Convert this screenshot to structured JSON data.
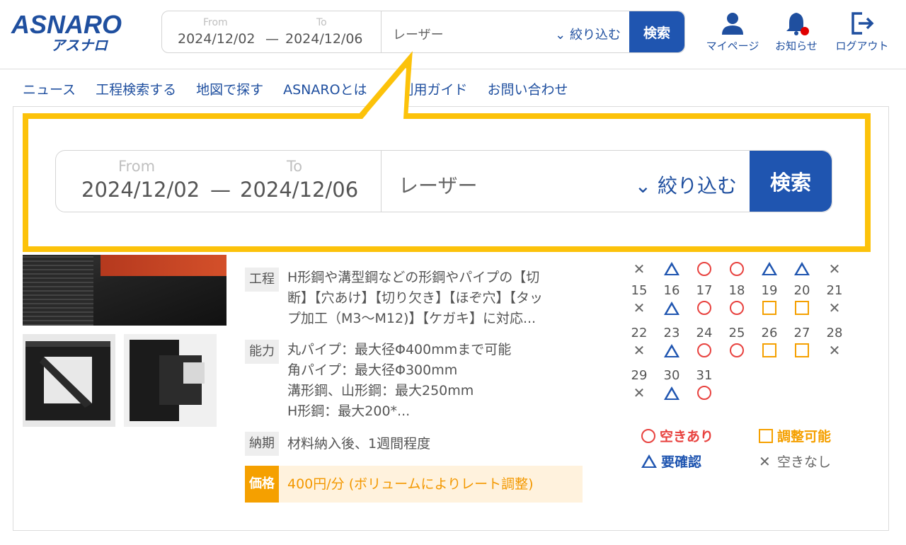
{
  "brand": {
    "logo": "ASNARO",
    "logo_sub": "アスナロ",
    "color": "#1f4f9f"
  },
  "search": {
    "from_label": "From",
    "to_label": "To",
    "from_date": "2024/12/02",
    "to_date": "2024/12/06",
    "separator": "—",
    "keyword": "レーザー",
    "filter_label": "絞り込む",
    "search_button": "検索"
  },
  "header_icons": {
    "mypage": "マイページ",
    "notifications": "お知らせ",
    "logout": "ログアウト"
  },
  "nav": [
    "ニュース",
    "工程検索する",
    "地図で探す",
    "ASNAROとは",
    "ご利用ガイド",
    "お問い合わせ"
  ],
  "detail": {
    "process_label": "工程",
    "process_lines": [
      "H形鋼や溝型鋼などの形鋼やパイプの【切",
      "断】【穴あけ】【切り欠き】【ほぞ穴】【タッ",
      "プ加工（M3～M12)】【ケガキ】に対応..."
    ],
    "capacity_label": "能力",
    "capacity_lines": [
      "丸パイプ：最大径Φ400mmまで可能",
      "角パイプ：最大径Φ300mm",
      "溝形鋼、山形鋼：最大250mm",
      "H形鋼：最大200*..."
    ],
    "delivery_label": "納期",
    "delivery_text": "材料納入後、1週間程度",
    "price_label": "価格",
    "price_text": "400円/分 (ボリュームによりレート調整)"
  },
  "calendar": {
    "first_row_marks": [
      "x",
      "t",
      "o",
      "o",
      "t",
      "t",
      "x"
    ],
    "weeks": [
      {
        "days": [
          "15",
          "16",
          "17",
          "18",
          "19",
          "20",
          "21"
        ],
        "marks": [
          "x",
          "t",
          "o",
          "o",
          "s",
          "s",
          "x"
        ]
      },
      {
        "days": [
          "22",
          "23",
          "24",
          "25",
          "26",
          "27",
          "28"
        ],
        "marks": [
          "x",
          "t",
          "o",
          "o",
          "s",
          "s",
          "x"
        ]
      },
      {
        "days": [
          "29",
          "30",
          "31"
        ],
        "marks": [
          "x",
          "t",
          "o"
        ]
      }
    ]
  },
  "legend": {
    "available": "空きあり",
    "adjustable": "調整可能",
    "confirm": "要確認",
    "none": "空きなし"
  },
  "colors": {
    "accent_blue": "#1f55b0",
    "callout": "#fcc20a",
    "available": "#e8423f",
    "adjustable": "#f5a000",
    "price_bg": "#fff2dd"
  }
}
